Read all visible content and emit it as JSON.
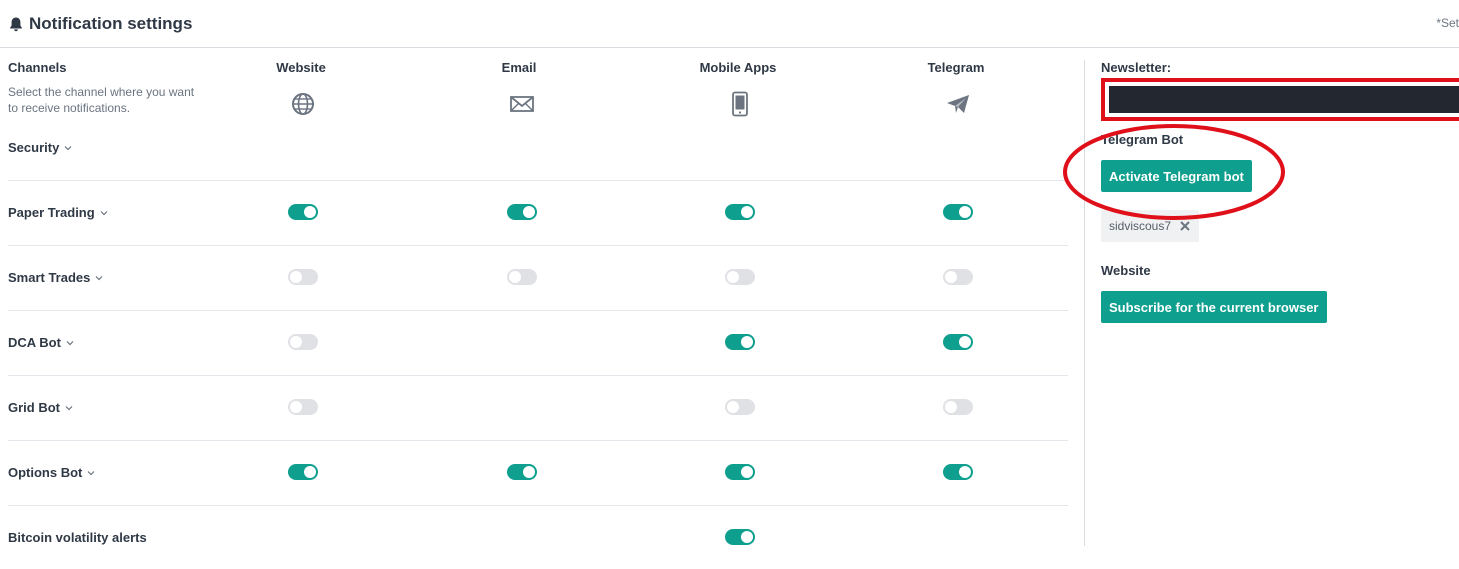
{
  "header": {
    "title": "Notification settings",
    "note": "*Set"
  },
  "icons": {
    "bell": "bell-icon",
    "website": "globe-icon",
    "email": "envelope-icon",
    "mobile": "phone-icon",
    "telegram": "paper-plane-icon",
    "chevron": "chevron-down-icon",
    "remove": "close-icon"
  },
  "channels": {
    "heading": "Channels",
    "description": "Select the channel where you want to receive notifications.",
    "columns": [
      "Website",
      "Email",
      "Mobile Apps",
      "Telegram"
    ]
  },
  "rows": [
    {
      "label": "Security",
      "chevron": true,
      "toggles": [
        null,
        null,
        null,
        null
      ]
    },
    {
      "label": "Paper Trading",
      "chevron": true,
      "toggles": [
        true,
        true,
        true,
        true
      ]
    },
    {
      "label": "Smart Trades",
      "chevron": true,
      "toggles": [
        false,
        false,
        false,
        false
      ]
    },
    {
      "label": "DCA Bot",
      "chevron": true,
      "toggles": [
        false,
        null,
        true,
        true
      ]
    },
    {
      "label": "Grid Bot",
      "chevron": true,
      "toggles": [
        false,
        null,
        false,
        false
      ]
    },
    {
      "label": "Options Bot",
      "chevron": true,
      "toggles": [
        true,
        true,
        true,
        true
      ]
    },
    {
      "label": "Bitcoin volatility alerts",
      "chevron": false,
      "toggles": [
        null,
        null,
        true,
        null
      ]
    }
  ],
  "sidebar": {
    "newsletter_label": "Newsletter:",
    "telegram_label": "Telegram Bot",
    "telegram_button": "Activate Telegram bot",
    "telegram_user": "sidviscous7",
    "website_label": "Website",
    "website_button": "Subscribe for the current browser"
  },
  "colors": {
    "accent": "#0e9f8e",
    "toggle_off": "#dfe1e5",
    "annotation": "#e0101b",
    "redacted": "#232730"
  }
}
